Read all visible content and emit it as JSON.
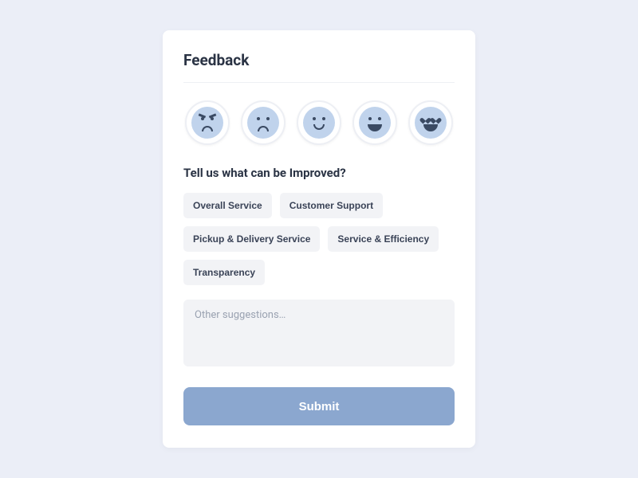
{
  "title": "Feedback",
  "emojis": [
    "angry",
    "sad",
    "slight-smile",
    "big-smile",
    "heart-eyes"
  ],
  "question": "Tell us what can be Improved?",
  "chips": [
    "Overall Service",
    "Customer Support",
    "Pickup & Delivery Service",
    "Service & Efficiency",
    "Transparency"
  ],
  "placeholder": "Other suggestions…",
  "submit": "Submit"
}
